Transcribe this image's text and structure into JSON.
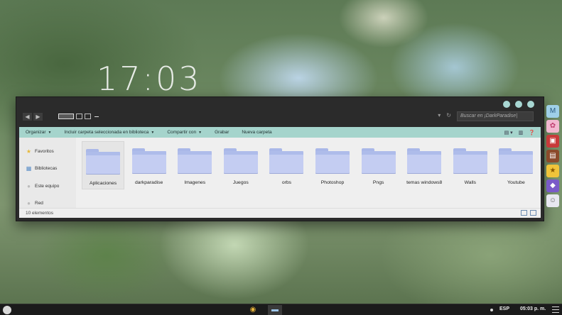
{
  "desktop": {
    "clock": "17:03"
  },
  "window": {
    "search_placeholder": "Buscar en ¡DarkParadise|",
    "toolbar": {
      "organize": "Organizar",
      "include": "Incluir carpeta seleccionada en biblioteca",
      "share": "Compartir con",
      "burn": "Grabar",
      "new_folder": "Nueva carpeta"
    },
    "sidebar": [
      {
        "label": "Favoritos",
        "icon": "star-icon"
      },
      {
        "label": "Bibliotecas",
        "icon": "library-icon"
      },
      {
        "label": "Este equipo",
        "icon": "computer-icon"
      },
      {
        "label": "Red",
        "icon": "network-icon"
      }
    ],
    "folders": [
      {
        "label": "Aplicaciones"
      },
      {
        "label": "darkparadise"
      },
      {
        "label": "Imagenes"
      },
      {
        "label": "Juegos"
      },
      {
        "label": "orbs"
      },
      {
        "label": "Photoshop"
      },
      {
        "label": "Pngs"
      },
      {
        "label": "temas windows8"
      },
      {
        "label": "Walls"
      },
      {
        "label": "Youtube"
      }
    ],
    "status": "10 elementos"
  },
  "taskbar": {
    "language": "ESP",
    "time": "05:03 p. m."
  },
  "colors": {
    "accent": "#a5d4cc",
    "window_bg": "#2b2b2b",
    "folder": "#c4cdf2"
  }
}
